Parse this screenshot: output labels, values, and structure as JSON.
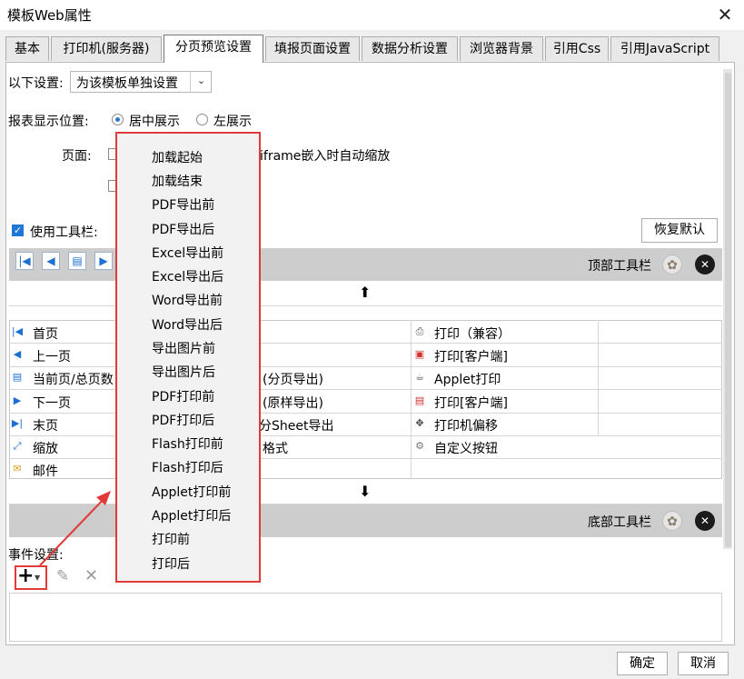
{
  "window": {
    "title": "模板Web属性",
    "close_glyph": "✕"
  },
  "tabs": [
    {
      "label": "基本"
    },
    {
      "label": "打印机(服务器)"
    },
    {
      "label": "分页预览设置"
    },
    {
      "label": "填报页面设置"
    },
    {
      "label": "数据分析设置"
    },
    {
      "label": "浏览器背景"
    },
    {
      "label": "引用Css"
    },
    {
      "label": "引用JavaScript"
    }
  ],
  "active_tab": 2,
  "settings": {
    "label": "以下设置:",
    "value": "为该模板单独设置"
  },
  "position": {
    "label": "报表显示位置:",
    "center": "居中展示",
    "left": "左展示",
    "selected": "center"
  },
  "page": {
    "label": "页面:",
    "option1": "iframe嵌入时自动缩放"
  },
  "toolbar": {
    "use_label": "使用工具栏:",
    "restore_label": "恢复默认",
    "top_label": "顶部工具栏",
    "bottom_label": "底部工具栏"
  },
  "list": {
    "left": [
      {
        "label": "首页",
        "icon": "first-page-icon"
      },
      {
        "label": "上一页",
        "icon": "prev-page-icon"
      },
      {
        "label": "当前页/总页数",
        "icon": "page-count-icon"
      },
      {
        "label": "下一页",
        "icon": "next-page-icon"
      },
      {
        "label": "末页",
        "icon": "last-page-icon"
      },
      {
        "label": "缩放",
        "icon": "zoom-icon"
      },
      {
        "label": "邮件",
        "icon": "mail-icon"
      }
    ],
    "middle": [
      {
        "label": ""
      },
      {
        "label": ""
      },
      {
        "label": "(分页导出)"
      },
      {
        "label": "(原样导出)"
      },
      {
        "label": "分Sheet导出"
      },
      {
        "label": "格式"
      },
      {
        "label": ""
      }
    ],
    "right": [
      {
        "label": "打印（兼容）",
        "icon": "printer-icon"
      },
      {
        "label": "打印[客户端]",
        "icon": "flash-print-icon"
      },
      {
        "label": "Applet打印",
        "icon": "applet-print-icon"
      },
      {
        "label": "打印[客户端]",
        "icon": "pdf-print-icon"
      },
      {
        "label": "打印机偏移",
        "icon": "move-icon"
      },
      {
        "label": "自定义按钮",
        "icon": "gear-icon"
      }
    ]
  },
  "events": {
    "label": "事件设置:"
  },
  "menu": {
    "items": [
      "加载起始",
      "加载结束",
      "PDF导出前",
      "PDF导出后",
      "Excel导出前",
      "Excel导出后",
      "Word导出前",
      "Word导出后",
      "导出图片前",
      "导出图片后",
      "PDF打印前",
      "PDF打印后",
      "Flash打印前",
      "Flash打印后",
      "Applet打印前",
      "Applet打印后",
      "打印前",
      "打印后"
    ]
  },
  "footer": {
    "ok": "确定",
    "cancel": "取消"
  },
  "colors": {
    "annotation_red": "#e03a3a",
    "accent_blue": "#1e76d6"
  }
}
